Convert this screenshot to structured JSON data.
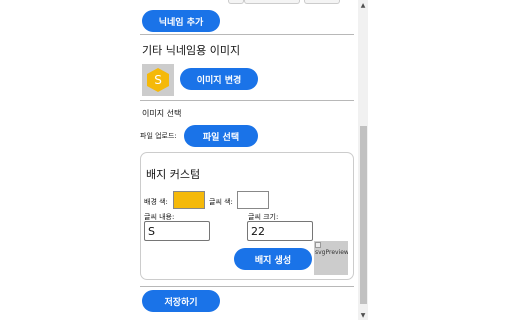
{
  "buttons": {
    "add_nickname": "닉네임 추가",
    "change_image": "이미지 변경",
    "select_file": "파일 선택",
    "generate_badge": "배지 생성",
    "save": "저장하기"
  },
  "nickname_image_section": {
    "title": "기타 닉네임용 이미지",
    "avatar_letter": "S"
  },
  "image_select": {
    "title": "이미지 선택",
    "file_upload_label": "파일 업로드:"
  },
  "badge_custom": {
    "title": "배지 커스텀",
    "bg_color_label": "배경 색:",
    "bg_color_value": "#f5b90a",
    "text_color_label": "글씨 색:",
    "text_color_value": "#ffffff",
    "text_content_label": "글씨 내용:",
    "text_content_value": "S",
    "font_size_label": "글씨 크기:",
    "font_size_value": "22",
    "preview_alt": "svgPreview"
  },
  "colors": {
    "primary": "#1a73e8",
    "avatar_bg": "#f5b90a"
  }
}
